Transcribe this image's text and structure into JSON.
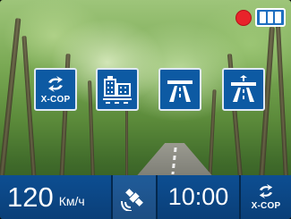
{
  "status": {
    "recording_icon": "record-dot-icon",
    "battery_icon": "battery-full-icon",
    "recording_color": "#e8232a"
  },
  "modes": [
    {
      "name": "X-COP",
      "icon": "x-cop-icon",
      "label": "X-COP"
    },
    {
      "name": "city",
      "icon": "city-icon"
    },
    {
      "name": "highway",
      "icon": "highway-icon"
    },
    {
      "name": "autobahn",
      "icon": "autobahn-icon"
    }
  ],
  "bottom_bar": {
    "speed_value": "120",
    "speed_unit": "Км/ч",
    "gps_icon": "gps-satellite-icon",
    "time": "10:00",
    "xcop_label": "X-COP"
  },
  "colors": {
    "accent": "#0d5aa3",
    "bar": "#0d4e92"
  }
}
